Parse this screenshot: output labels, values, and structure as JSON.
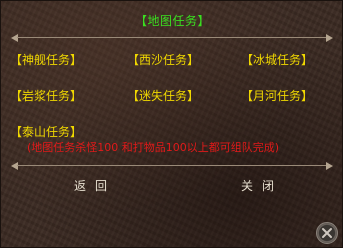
{
  "title": "【地图任务】",
  "tasks": [
    {
      "label": "【神舰任务】"
    },
    {
      "label": "【西沙任务】"
    },
    {
      "label": "【冰城任务】"
    },
    {
      "label": "【岩浆任务】"
    },
    {
      "label": "【迷失任务】"
    },
    {
      "label": "【月河任务】"
    },
    {
      "label": "【泰山任务】"
    }
  ],
  "note": "(地图任务杀怪100 和打物品100以上都可组队完成)",
  "buttons": {
    "back": "返回",
    "close": "关闭"
  },
  "icons": {
    "corner_close": "close-x-icon"
  },
  "colors": {
    "title": "#3ae020",
    "task": "#f0d800",
    "note": "#e01a1a",
    "button": "#e8e0d0"
  }
}
